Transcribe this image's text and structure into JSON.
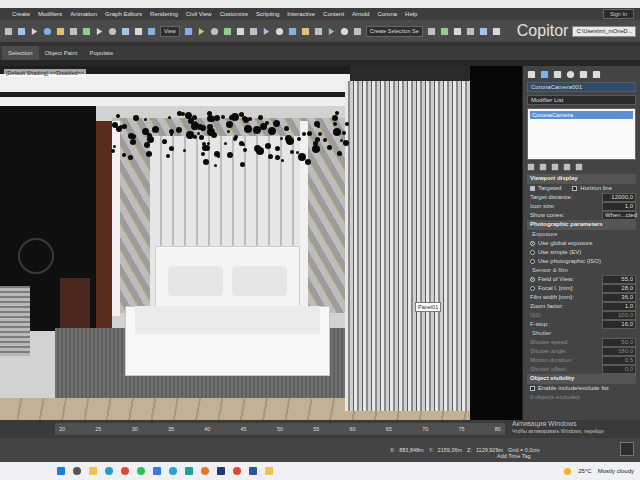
{
  "menu": [
    "Create",
    "Modifiers",
    "Animation",
    "Graph Editors",
    "Rendering",
    "Civil View",
    "Customize",
    "Scripting",
    "Interactive",
    "Content",
    "Arnold",
    "Corona",
    "Help"
  ],
  "sign_in": "Sign In",
  "toolbar": {
    "view": "View",
    "selection_set": "Create Selection Se",
    "workspace": "Copitor",
    "path": "C:\\Users\\m\\_mOneD..."
  },
  "ribbon": [
    {
      "label": "Selection",
      "selected": true
    },
    {
      "label": "Object Paint",
      "selected": false
    },
    {
      "label": "Populate",
      "selected": false
    }
  ],
  "viewport": {
    "label": "[Default Shading]  <<Disabled>>",
    "tooltip": "Panel01"
  },
  "command_panel": {
    "object_name": "CoronaCamera001",
    "modifier_list": "Modifier List",
    "stack": [
      {
        "label": "CoronaCamera",
        "selected": true
      }
    ],
    "rollouts": [
      {
        "title": "Viewport display",
        "rows": [
          {
            "kind": "checks",
            "items": [
              {
                "label": "Targeted",
                "checked": true
              },
              {
                "label": "Horizon line",
                "checked": false
              }
            ]
          },
          {
            "kind": "field",
            "label": "Target distance:",
            "value": "12000,0",
            "disabled": false
          },
          {
            "kind": "field",
            "label": "Icon size:",
            "value": "1,0",
            "disabled": false
          },
          {
            "kind": "field",
            "label": "Show cones:",
            "value": "When...cted",
            "disabled": false
          }
        ]
      },
      {
        "title": "Photographic parameters",
        "rows": [
          {
            "kind": "heading",
            "label": "Exposure"
          },
          {
            "kind": "radio",
            "label": "Use global exposure",
            "selected": true
          },
          {
            "kind": "radio",
            "label": "Use simple (EV)",
            "selected": false
          },
          {
            "kind": "radio",
            "label": "Use photographic (ISO)",
            "selected": false
          },
          {
            "kind": "heading",
            "label": "Sensor & film"
          },
          {
            "kind": "radiofield",
            "label": "Field of View:",
            "value": "55,0",
            "selected": true
          },
          {
            "kind": "radiofield",
            "label": "Focal l. [mm]:",
            "value": "28,0",
            "selected": false
          },
          {
            "kind": "field",
            "label": "Film width [mm]:",
            "value": "36,0",
            "disabled": false
          },
          {
            "kind": "field",
            "label": "Zoom factor:",
            "value": "1,0",
            "disabled": false
          },
          {
            "kind": "field",
            "label": "ISO:",
            "value": "100,0",
            "disabled": true
          },
          {
            "kind": "field",
            "label": "F-stop:",
            "value": "16,0",
            "disabled": false
          },
          {
            "kind": "heading",
            "label": "Shutter"
          },
          {
            "kind": "field",
            "label": "Shutter speed:",
            "value": "50,0",
            "disabled": true
          },
          {
            "kind": "field",
            "label": "Shutter angle:",
            "value": "180,0",
            "disabled": true
          },
          {
            "kind": "field",
            "label": "Motion duration:",
            "value": "0,5",
            "disabled": true
          },
          {
            "kind": "field",
            "label": "Shutter offset:",
            "value": "0,0",
            "disabled": true
          }
        ]
      },
      {
        "title": "Object visibility",
        "rows": [
          {
            "kind": "checks",
            "items": [
              {
                "label": "Enable include/exclude list",
                "checked": false
              }
            ]
          },
          {
            "kind": "text",
            "label": "0 objects excluded"
          }
        ]
      }
    ]
  },
  "timeline": {
    "ticks": [
      "20",
      "25",
      "30",
      "35",
      "40",
      "45",
      "50",
      "55",
      "60",
      "65",
      "70",
      "75",
      "80"
    ]
  },
  "status": {
    "coords": [
      {
        "axis": "X:",
        "value": "883,848m"
      },
      {
        "axis": "Y:",
        "value": "2159,36m"
      },
      {
        "axis": "Z:",
        "value": "1129,929m"
      }
    ],
    "grid": "Grid = 0,0cm",
    "time_tag": "Add Time Tag"
  },
  "watermark": {
    "title": "Активация Windows",
    "text": "Чтобы активировать Windows, перейди"
  },
  "taskbar": {
    "temperature": "25°C",
    "weather": "Mostly cloudy"
  }
}
